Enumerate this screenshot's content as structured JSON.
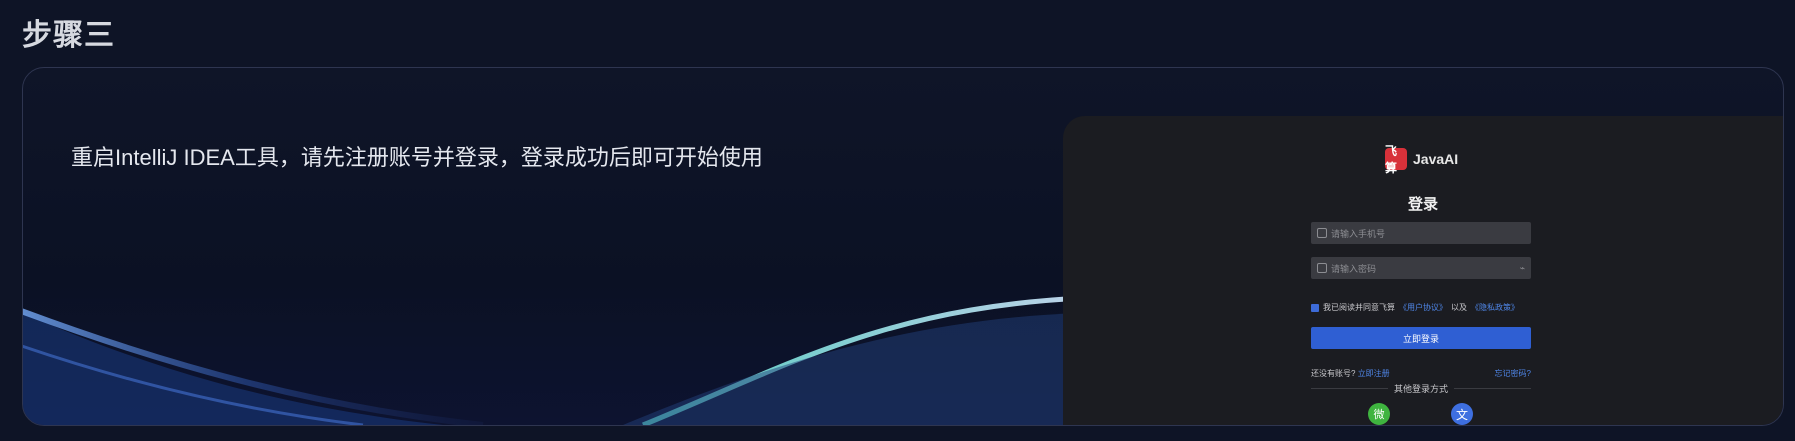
{
  "step": {
    "title": "步骤三"
  },
  "card": {
    "description": "重启IntelliJ IDEA工具，请先注册账号并登录，登录成功后即可开始使用"
  },
  "login": {
    "logo_text": "飞算",
    "brand": "JavaAI",
    "title": "登录",
    "phone_placeholder": "请输入手机号",
    "password_placeholder": "请输入密码",
    "agree_prefix": "我已阅读并同意飞算",
    "user_agreement": "《用户协议》",
    "agree_and": "以及",
    "privacy_policy": "《隐私政策》",
    "login_button": "立即登录",
    "no_account": "还没有账号?",
    "register_link": "立即注册",
    "forgot_link": "忘记密码?",
    "other_methods": "其他登录方式",
    "wechat_glyph": "微",
    "alt_glyph": "文"
  },
  "colors": {
    "background": "#0e1426",
    "accent": "#2f5fd3",
    "wechat": "#3fb43f",
    "brand_red": "#d8313a"
  }
}
